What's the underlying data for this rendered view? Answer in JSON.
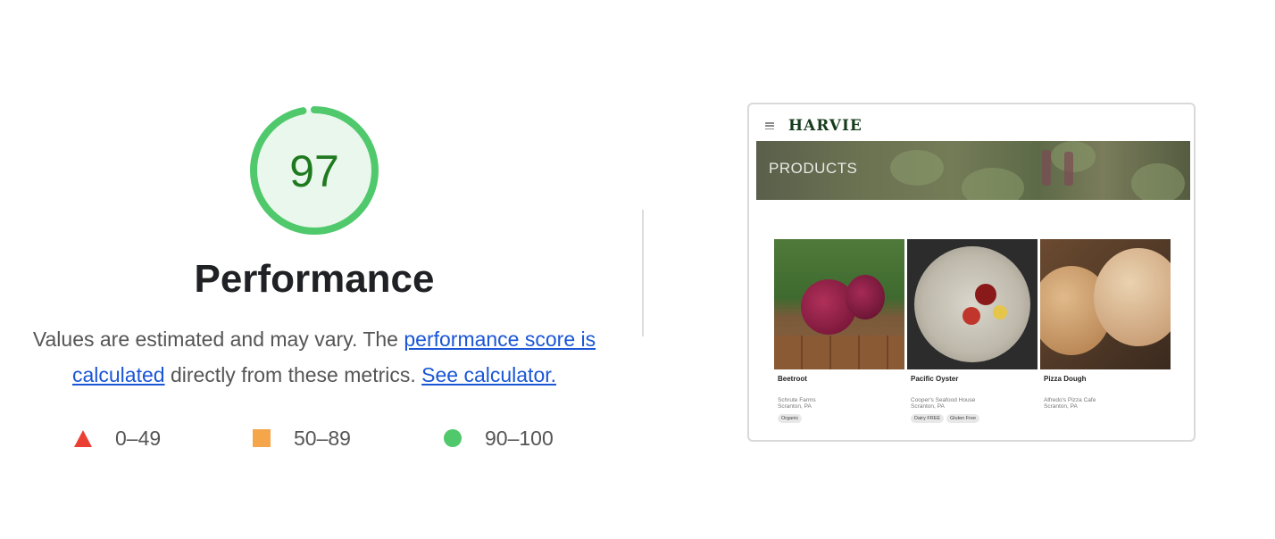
{
  "report": {
    "score": "97",
    "score_fraction": 0.97,
    "category_title": "Performance",
    "description": {
      "intro": "Values are estimated and may vary. The ",
      "score_link": "performance score is calculated",
      "middle": " directly from these metrics. ",
      "calculator_link": "See calculator."
    },
    "legend": [
      {
        "shape": "triangle-icon",
        "color": "#eb3f34",
        "label": "0–49"
      },
      {
        "shape": "square-icon",
        "color": "#f5a54a",
        "label": "50–89"
      },
      {
        "shape": "circle-icon",
        "color": "#4fc96b",
        "label": "90–100"
      }
    ],
    "colors": {
      "pass": "#4fc96b",
      "pass_fill": "#eaf7ec",
      "score_text": "#1f7a1f"
    }
  },
  "screenshot": {
    "brand": "HARVIE",
    "hero_text": "PRODUCTS",
    "products": [
      {
        "name": "Beetroot",
        "farm": "Schrute Farms",
        "location": "Scranton, PA",
        "tags": [
          "Organic"
        ]
      },
      {
        "name": "Pacific Oyster",
        "farm": "Cooper's Seafood House",
        "location": "Scranton, PA",
        "tags": [
          "Dairy FREE",
          "Gluten Free"
        ]
      },
      {
        "name": "Pizza Dough",
        "farm": "Alfredo's Pizza Cafe",
        "location": "Scranton, PA",
        "tags": []
      }
    ]
  }
}
